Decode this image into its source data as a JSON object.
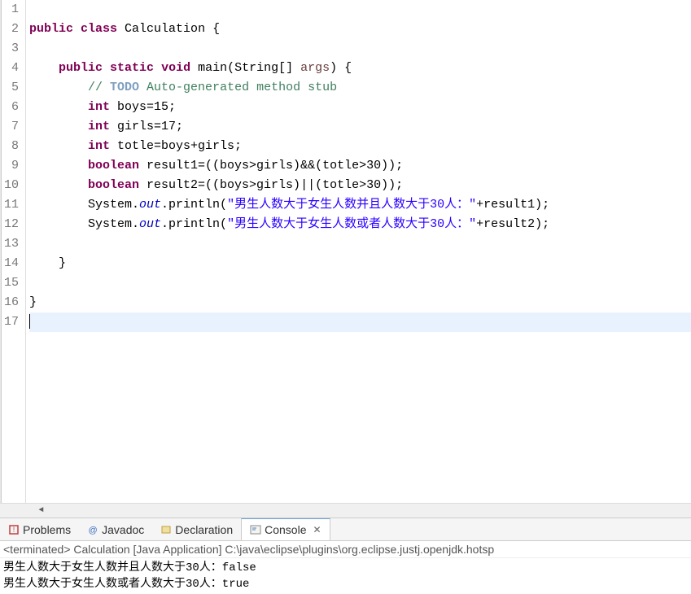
{
  "editor": {
    "line_numbers": [
      "1",
      "2",
      "3",
      "4",
      "5",
      "6",
      "7",
      "8",
      "9",
      "10",
      "11",
      "12",
      "13",
      "14",
      "15",
      "16",
      "17"
    ],
    "highlighted_line": 17,
    "override_marker_line": 4,
    "run_marker_line": 5,
    "code": {
      "l1": "",
      "l2_kw1": "public",
      "l2_kw2": "class",
      "l2_name": " Calculation {",
      "l3": "",
      "l4_kw1": "public",
      "l4_kw2": "static",
      "l4_kw3": "void",
      "l4_name": " main(String[] ",
      "l4_param": "args",
      "l4_end": ") {",
      "l5_comment_slash": "// ",
      "l5_todo": "TODO",
      "l5_comment_rest": " Auto-generated method stub",
      "l6_kw": "int",
      "l6_rest": " boys=15;",
      "l7_kw": "int",
      "l7_rest": " girls=17;",
      "l8_kw": "int",
      "l8_rest": " totle=boys+girls;",
      "l9_kw": "boolean",
      "l9_rest": " result1=((boys>girls)&&(totle>30));",
      "l10_kw": "boolean",
      "l10_rest": " result2=((boys>girls)||(totle>30));",
      "l11_a": "System.",
      "l11_out": "out",
      "l11_b": ".println(",
      "l11_str": "\"男生人数大于女生人数并且人数大于30人：\"",
      "l11_c": "+result1);",
      "l12_a": "System.",
      "l12_out": "out",
      "l12_b": ".println(",
      "l12_str": "\"男生人数大于女生人数或者人数大于30人：\"",
      "l12_c": "+result2);",
      "l13": "",
      "l14": "    }",
      "l15": "",
      "l16": "}",
      "l17": ""
    }
  },
  "tabs": {
    "problems": "Problems",
    "javadoc": "Javadoc",
    "declaration": "Declaration",
    "console": "Console"
  },
  "console": {
    "status": "<terminated> Calculation [Java Application] C:\\java\\eclipse\\plugins\\org.eclipse.justj.openjdk.hotsp",
    "output": [
      "男生人数大于女生人数并且人数大于30人：false",
      "男生人数大于女生人数或者人数大于30人：true"
    ]
  }
}
